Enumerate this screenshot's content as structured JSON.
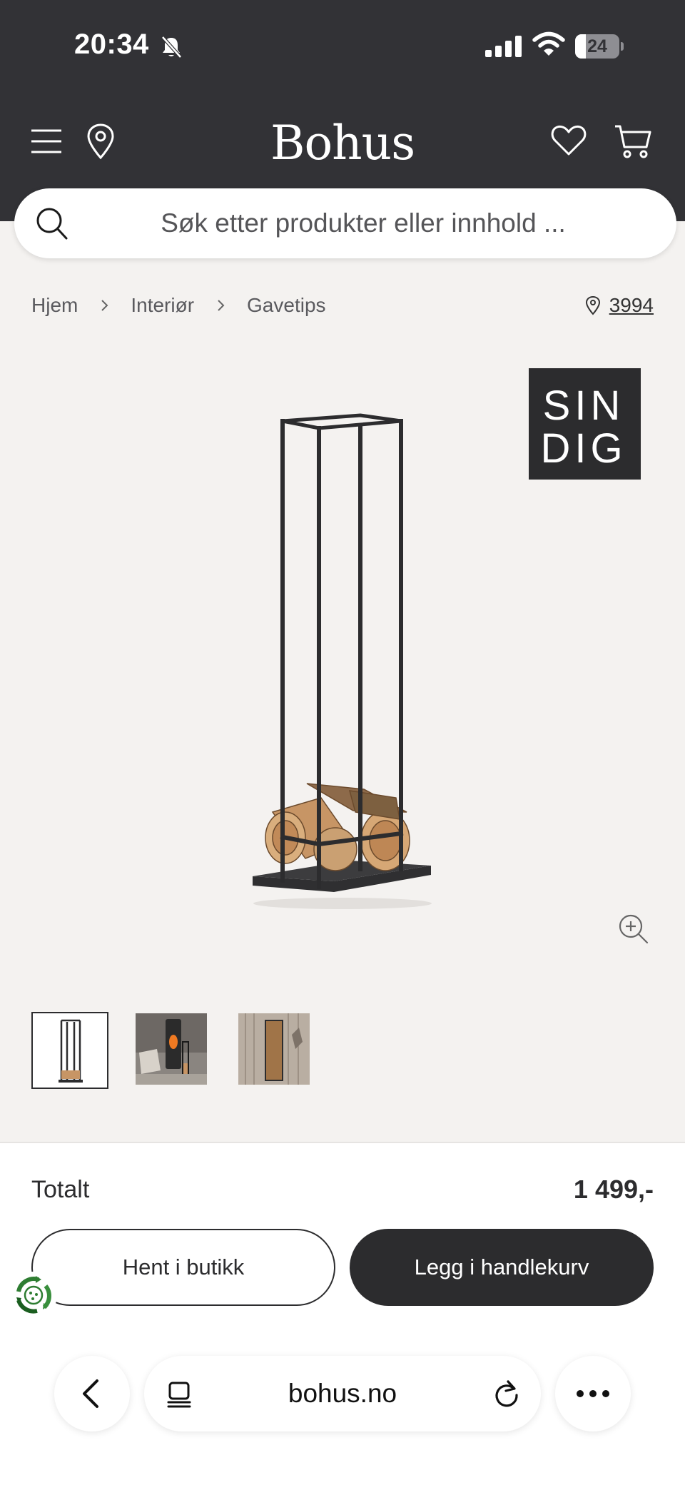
{
  "status_bar": {
    "time": "20:34",
    "battery": "24",
    "battery_level": 0.24
  },
  "header": {
    "logo": "Bohus",
    "colors": {
      "header_bg": "#323236",
      "page_bg": "#f4f2f0",
      "accent": "#2c2c2e"
    },
    "icons": [
      "menu-icon",
      "location-pin-icon",
      "heart-icon",
      "cart-icon"
    ]
  },
  "search": {
    "placeholder": "Søk etter produkter eller innhold ..."
  },
  "breadcrumb": {
    "items": [
      "Hjem",
      "Interiør",
      "Gavetips"
    ]
  },
  "store": {
    "label": "3994"
  },
  "product": {
    "brand_logo": "SINDIG",
    "image": "firewood-rack",
    "thumbnails": [
      "firewood-rack",
      "living-room-fireplace",
      "firewood-rack-room"
    ]
  },
  "cart": {
    "total_label": "Totalt",
    "total_price": "1 499,-",
    "pickup_button": "Hent i butikk",
    "add_to_cart_button": "Legg i handlekurv"
  },
  "browser": {
    "url": "bohus.no"
  }
}
